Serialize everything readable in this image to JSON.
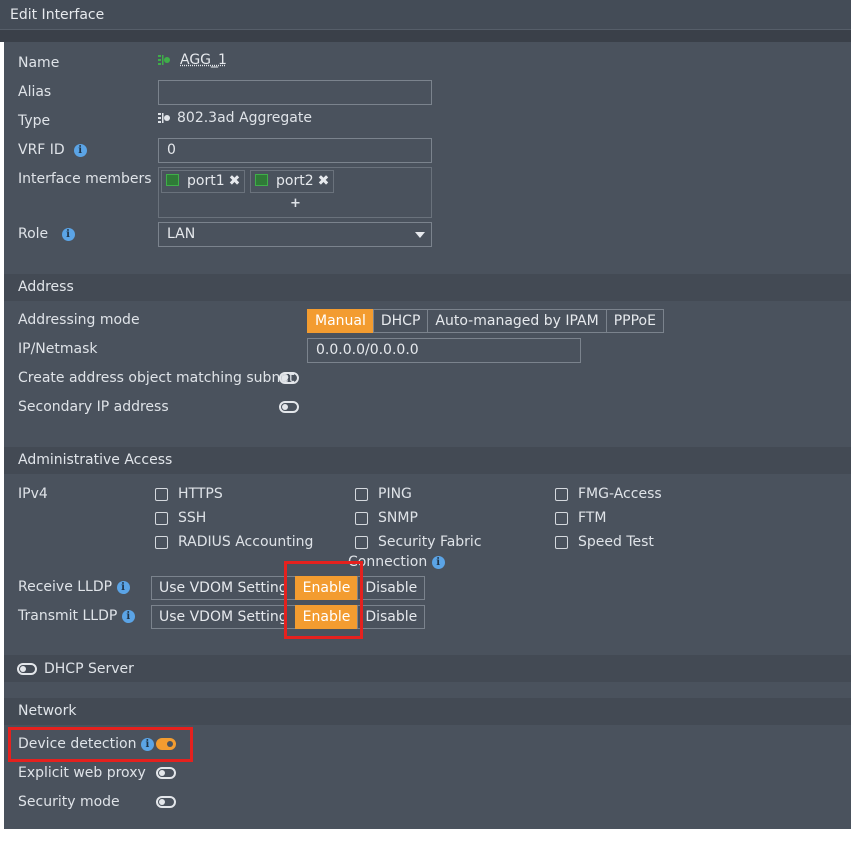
{
  "window": {
    "title": "Edit Interface"
  },
  "general": {
    "name_label": "Name",
    "name_value": "AGG_1",
    "alias_label": "Alias",
    "alias_value": "",
    "type_label": "Type",
    "type_value": "802.3ad Aggregate",
    "vrf_label": "VRF ID",
    "vrf_value": "0",
    "members_label": "Interface members",
    "members": [
      {
        "name": "port1"
      },
      {
        "name": "port2"
      }
    ],
    "add_symbol": "+",
    "remove_symbol": "✖",
    "role_label": "Role",
    "role_value": "LAN"
  },
  "address": {
    "header": "Address",
    "mode_label": "Addressing mode",
    "modes": [
      "Manual",
      "DHCP",
      "Auto-managed by IPAM",
      "PPPoE"
    ],
    "active_mode": "Manual",
    "ipmask_label": "IP/Netmask",
    "ipmask_value": "0.0.0.0/0.0.0.0",
    "create_obj_label": "Create address object matching subnet",
    "create_obj_enabled": false,
    "secondary_label": "Secondary IP address",
    "secondary_enabled": false
  },
  "admin": {
    "header": "Administrative Access",
    "ipv4_label": "IPv4",
    "options": [
      {
        "label": "HTTPS",
        "checked": false
      },
      {
        "label": "PING",
        "checked": false
      },
      {
        "label": "FMG-Access",
        "checked": false
      },
      {
        "label": "SSH",
        "checked": false
      },
      {
        "label": "SNMP",
        "checked": false
      },
      {
        "label": "FTM",
        "checked": false
      },
      {
        "label": "RADIUS Accounting",
        "checked": false
      },
      {
        "label": "Security Fabric",
        "label2": "Connection",
        "checked": false
      },
      {
        "label": "Speed Test",
        "checked": false
      }
    ],
    "receive_label": "Receive LLDP",
    "transmit_label": "Transmit LLDP",
    "lldp_options": [
      "Use VDOM Setting",
      "Enable",
      "Disable"
    ],
    "receive_active": "Enable",
    "transmit_active": "Enable"
  },
  "dhcp": {
    "label": "DHCP Server",
    "enabled": false
  },
  "network": {
    "header": "Network",
    "device_detection_label": "Device detection",
    "device_detection_enabled": true,
    "explicit_proxy_label": "Explicit web proxy",
    "explicit_proxy_enabled": false,
    "security_mode_label": "Security mode",
    "security_mode_enabled": false
  },
  "colors": {
    "accent": "#f39c30",
    "highlight": "#e5211e",
    "panel": "#4a525d",
    "info": "#5ba4e6"
  },
  "icons": {
    "aggregate": "aggregate-interface-icon",
    "port": "port-icon",
    "info": "info-icon"
  }
}
